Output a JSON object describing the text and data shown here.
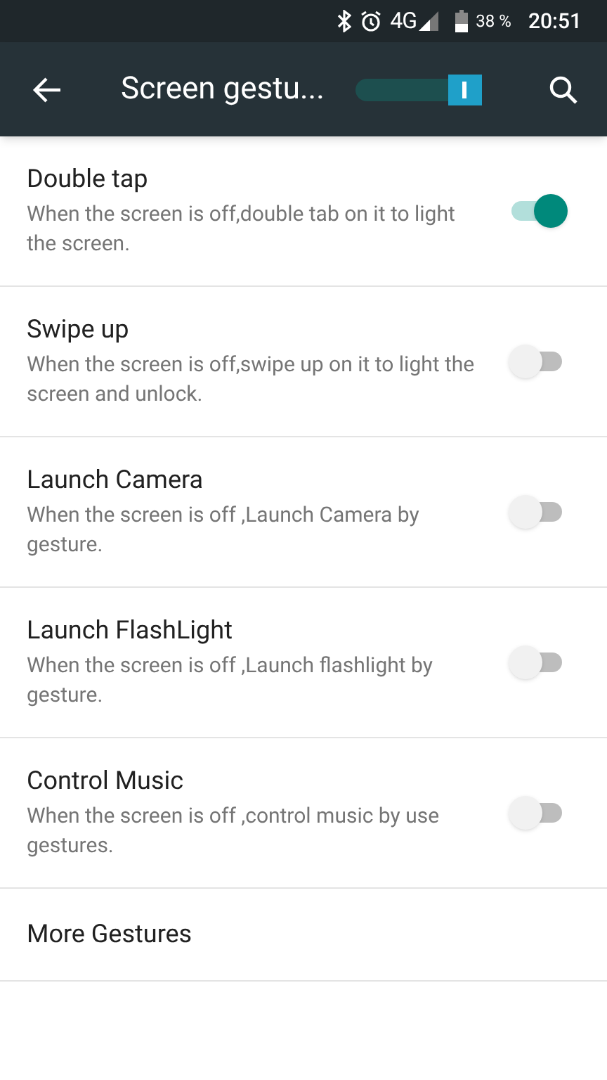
{
  "status_bar": {
    "network": "4G",
    "battery_percent": "38 %",
    "time": "20:51"
  },
  "app_bar": {
    "title": "Screen gestu...",
    "master_switch": {
      "on": true
    }
  },
  "settings": [
    {
      "kind": "toggle",
      "title": "Double tap",
      "summary": "When the screen is off,double tab on it to light the screen.",
      "on": true
    },
    {
      "kind": "toggle",
      "title": "Swipe up",
      "summary": "When the screen is off,swipe up on it to light the screen and unlock.",
      "on": false
    },
    {
      "kind": "toggle",
      "title": "Launch Camera",
      "summary": "When the screen is off ,Launch Camera by gesture.",
      "on": false
    },
    {
      "kind": "toggle",
      "title": "Launch FlashLight",
      "summary": "When the screen is off ,Launch flashlight by gesture.",
      "on": false
    },
    {
      "kind": "toggle",
      "title": "Control Music",
      "summary": "When the screen is off ,control music by use gestures.",
      "on": false
    },
    {
      "kind": "link",
      "title": "More Gestures"
    }
  ]
}
